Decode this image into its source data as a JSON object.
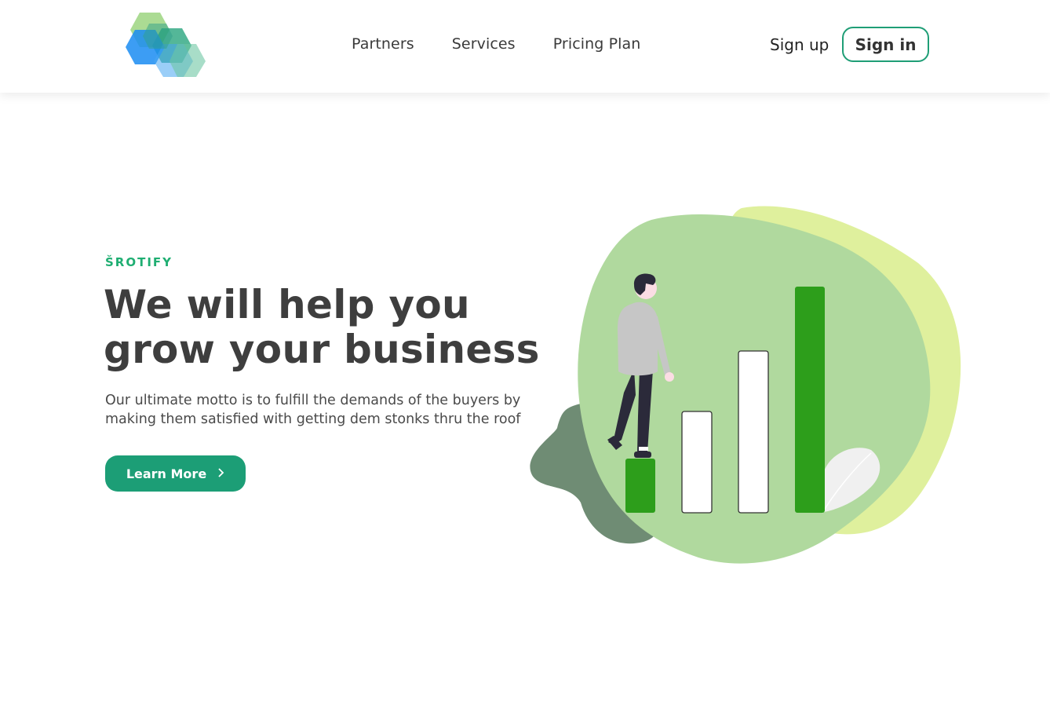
{
  "header": {
    "nav": {
      "partners": "Partners",
      "services": "Services",
      "pricing": "Pricing Plan"
    },
    "signup_label": "Sign up",
    "signin_label": "Sign in"
  },
  "hero": {
    "eyebrow": "ŠROTIFY",
    "headline_line1": "We will help you",
    "headline_line2": "grow your business",
    "subtext": "Our ultimate motto is to fulfill the demands of the buyers by making them satisfied with getting dem stonks thru the roof",
    "cta_label": "Learn More",
    "cta_icon": "chevron-right-icon"
  },
  "colors": {
    "accent": "#1c9e76",
    "eyebrow": "#1fae72",
    "bar_green": "#2d9e1b",
    "blob_green": "#b0d99e",
    "blob_lime": "#dff09d",
    "blob_dark": "#6f8c74"
  }
}
